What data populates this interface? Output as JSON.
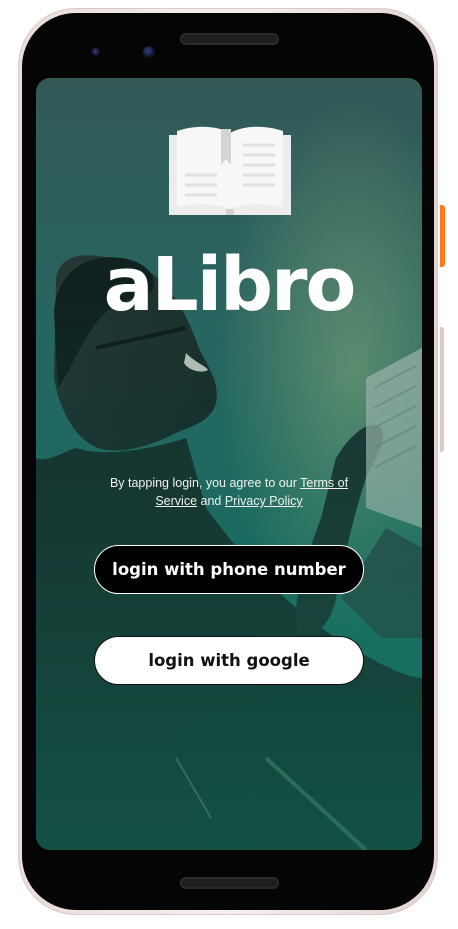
{
  "app": {
    "name": "aLibro"
  },
  "legal": {
    "prefix": "By tapping login, you agree to our ",
    "terms_link": "Terms of Service",
    "conjunction": " and ",
    "privacy_link": "Privacy Policy"
  },
  "buttons": {
    "phone_login": "login with phone number",
    "google_login": "login with google"
  },
  "colors": {
    "screen_tint": "#1d6e62",
    "phone_button_bg": "#000000",
    "google_button_bg": "#ffffff",
    "side_accent": "#ff7a1a"
  },
  "icons": {
    "logo": "open-book-icon"
  }
}
